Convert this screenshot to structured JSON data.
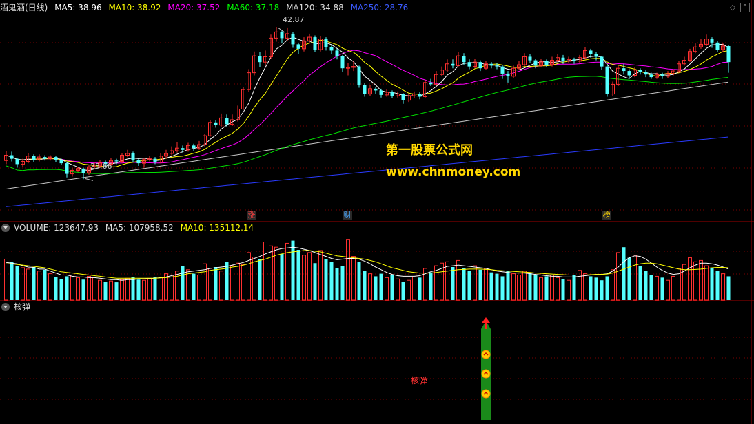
{
  "main_header": {
    "stock_name": "酒鬼酒(日线)",
    "indicators": [
      {
        "label": "MA5: 38.96",
        "color": "#ffffff"
      },
      {
        "label": "MA10: 38.92",
        "color": "#ffff00"
      },
      {
        "label": "MA20: 37.52",
        "color": "#ff00ff"
      },
      {
        "label": "MA60: 37.18",
        "color": "#00ff00"
      },
      {
        "label": "MA120: 34.88",
        "color": "#dddddd"
      },
      {
        "label": "MA250: 28.76",
        "color": "#3b5bff"
      }
    ]
  },
  "volume_header": {
    "indicators": [
      {
        "label": "VOLUME: 123647.93",
        "color": "#dddddd"
      },
      {
        "label": "MA5: 107958.52",
        "color": "#dddddd"
      },
      {
        "label": "MA10: 135112.14",
        "color": "#ffff00"
      }
    ]
  },
  "indicator_header": {
    "title": "核弹"
  },
  "watermark": {
    "line1": "第一股票公式网",
    "line2": "www.chnmoney.com"
  },
  "events": [
    {
      "label": "涨",
      "color": "#ff4040"
    },
    {
      "label": "财",
      "color": "#4aa8ff"
    },
    {
      "label": "榜",
      "color": "#ffd700"
    }
  ],
  "indicator_signal_label": "核弹",
  "colors": {
    "up": "#ff3030",
    "down": "#54ffff",
    "grid": "#7a0000",
    "signal": "#1a8a1a"
  },
  "chart_data": {
    "type": "candlestick",
    "price_range": [
      22,
      44.5
    ],
    "high_label": "42.87",
    "low_label": "25.66",
    "volume_range": [
      0,
      100000
    ],
    "candles": [
      {
        "o": 27.8,
        "c": 28.4,
        "h": 28.9,
        "l": 27.4
      },
      {
        "o": 28.4,
        "c": 28.0,
        "h": 28.8,
        "l": 27.7
      },
      {
        "o": 28.0,
        "c": 27.4,
        "h": 28.1,
        "l": 27.0
      },
      {
        "o": 27.4,
        "c": 27.7,
        "h": 28.0,
        "l": 27.1
      },
      {
        "o": 27.7,
        "c": 28.3,
        "h": 28.6,
        "l": 27.5
      },
      {
        "o": 28.3,
        "c": 27.9,
        "h": 28.5,
        "l": 27.6
      },
      {
        "o": 27.9,
        "c": 28.2,
        "h": 28.5,
        "l": 27.7
      },
      {
        "o": 28.2,
        "c": 28.0,
        "h": 28.4,
        "l": 27.8
      },
      {
        "o": 28.0,
        "c": 28.2,
        "h": 28.4,
        "l": 27.8
      },
      {
        "o": 28.2,
        "c": 27.9,
        "h": 28.3,
        "l": 27.6
      },
      {
        "o": 27.9,
        "c": 27.5,
        "h": 28.0,
        "l": 27.3
      },
      {
        "o": 27.5,
        "c": 26.3,
        "h": 27.6,
        "l": 25.9
      },
      {
        "o": 26.3,
        "c": 26.7,
        "h": 27.0,
        "l": 26.0
      },
      {
        "o": 26.7,
        "c": 26.9,
        "h": 27.1,
        "l": 26.5
      },
      {
        "o": 26.9,
        "c": 26.4,
        "h": 27.0,
        "l": 25.7
      },
      {
        "o": 26.4,
        "c": 27.1,
        "h": 27.3,
        "l": 26.2
      },
      {
        "o": 27.1,
        "c": 27.2,
        "h": 27.6,
        "l": 26.9
      },
      {
        "o": 27.2,
        "c": 27.6,
        "h": 27.9,
        "l": 27.0
      },
      {
        "o": 27.6,
        "c": 27.4,
        "h": 27.8,
        "l": 27.1
      },
      {
        "o": 27.4,
        "c": 27.8,
        "h": 28.1,
        "l": 27.2
      },
      {
        "o": 27.8,
        "c": 27.7,
        "h": 28.0,
        "l": 27.4
      },
      {
        "o": 27.7,
        "c": 28.4,
        "h": 28.6,
        "l": 27.5
      },
      {
        "o": 28.4,
        "c": 28.6,
        "h": 29.0,
        "l": 28.2
      },
      {
        "o": 28.6,
        "c": 27.9,
        "h": 28.8,
        "l": 27.6
      },
      {
        "o": 27.9,
        "c": 27.5,
        "h": 28.0,
        "l": 27.2
      },
      {
        "o": 27.5,
        "c": 27.9,
        "h": 28.1,
        "l": 27.0
      },
      {
        "o": 27.9,
        "c": 28.0,
        "h": 28.3,
        "l": 27.7
      },
      {
        "o": 28.0,
        "c": 27.6,
        "h": 28.2,
        "l": 27.4
      },
      {
        "o": 27.6,
        "c": 28.3,
        "h": 28.6,
        "l": 27.5
      },
      {
        "o": 28.3,
        "c": 28.6,
        "h": 29.0,
        "l": 28.0
      },
      {
        "o": 28.6,
        "c": 28.9,
        "h": 29.4,
        "l": 28.4
      },
      {
        "o": 28.9,
        "c": 29.2,
        "h": 29.9,
        "l": 28.7
      },
      {
        "o": 29.2,
        "c": 29.0,
        "h": 29.5,
        "l": 28.7
      },
      {
        "o": 29.0,
        "c": 29.5,
        "h": 29.8,
        "l": 28.8
      },
      {
        "o": 29.5,
        "c": 29.2,
        "h": 29.7,
        "l": 28.9
      },
      {
        "o": 29.2,
        "c": 29.6,
        "h": 30.0,
        "l": 29.0
      },
      {
        "o": 29.6,
        "c": 30.6,
        "h": 30.8,
        "l": 29.4
      },
      {
        "o": 30.6,
        "c": 32.1,
        "h": 32.4,
        "l": 30.5
      },
      {
        "o": 32.1,
        "c": 31.8,
        "h": 32.4,
        "l": 31.5
      },
      {
        "o": 31.8,
        "c": 32.6,
        "h": 33.1,
        "l": 31.6
      },
      {
        "o": 32.6,
        "c": 31.9,
        "h": 33.0,
        "l": 31.6
      },
      {
        "o": 31.9,
        "c": 32.4,
        "h": 33.0,
        "l": 31.7
      },
      {
        "o": 32.4,
        "c": 33.6,
        "h": 34.0,
        "l": 32.2
      },
      {
        "o": 33.6,
        "c": 35.8,
        "h": 36.1,
        "l": 33.5
      },
      {
        "o": 35.8,
        "c": 37.7,
        "h": 38.1,
        "l": 35.5
      },
      {
        "o": 37.7,
        "c": 39.6,
        "h": 40.1,
        "l": 37.4
      },
      {
        "o": 39.6,
        "c": 38.9,
        "h": 40.0,
        "l": 38.3
      },
      {
        "o": 38.9,
        "c": 39.5,
        "h": 40.2,
        "l": 38.5
      },
      {
        "o": 39.5,
        "c": 41.6,
        "h": 42.0,
        "l": 39.3
      },
      {
        "o": 41.6,
        "c": 42.3,
        "h": 42.87,
        "l": 41.2
      },
      {
        "o": 42.3,
        "c": 41.6,
        "h": 42.5,
        "l": 41.0
      },
      {
        "o": 41.6,
        "c": 42.1,
        "h": 42.8,
        "l": 41.3
      },
      {
        "o": 42.1,
        "c": 40.9,
        "h": 42.3,
        "l": 40.5
      },
      {
        "o": 40.9,
        "c": 40.4,
        "h": 41.1,
        "l": 39.8
      },
      {
        "o": 40.4,
        "c": 41.3,
        "h": 41.7,
        "l": 40.1
      },
      {
        "o": 41.3,
        "c": 41.7,
        "h": 42.1,
        "l": 41.0
      },
      {
        "o": 41.7,
        "c": 40.3,
        "h": 41.9,
        "l": 40.0
      },
      {
        "o": 40.3,
        "c": 41.5,
        "h": 41.8,
        "l": 40.1
      },
      {
        "o": 41.5,
        "c": 40.6,
        "h": 41.7,
        "l": 40.2
      },
      {
        "o": 40.6,
        "c": 40.2,
        "h": 40.8,
        "l": 39.8
      },
      {
        "o": 40.2,
        "c": 39.6,
        "h": 40.4,
        "l": 39.2
      },
      {
        "o": 39.6,
        "c": 38.2,
        "h": 39.7,
        "l": 37.8
      },
      {
        "o": 38.2,
        "c": 38.3,
        "h": 38.8,
        "l": 37.4
      },
      {
        "o": 38.3,
        "c": 38.4,
        "h": 39.0,
        "l": 37.9
      },
      {
        "o": 38.4,
        "c": 36.3,
        "h": 38.5,
        "l": 36.0
      },
      {
        "o": 36.3,
        "c": 35.3,
        "h": 36.5,
        "l": 35.0
      },
      {
        "o": 35.3,
        "c": 35.9,
        "h": 36.3,
        "l": 35.1
      },
      {
        "o": 35.9,
        "c": 35.7,
        "h": 36.1,
        "l": 35.3
      },
      {
        "o": 35.7,
        "c": 35.2,
        "h": 35.9,
        "l": 34.9
      },
      {
        "o": 35.2,
        "c": 35.5,
        "h": 35.8,
        "l": 35.0
      },
      {
        "o": 35.5,
        "c": 35.1,
        "h": 35.7,
        "l": 34.8
      },
      {
        "o": 35.1,
        "c": 35.3,
        "h": 35.6,
        "l": 34.9
      },
      {
        "o": 35.3,
        "c": 34.6,
        "h": 35.4,
        "l": 34.2
      },
      {
        "o": 34.6,
        "c": 35.1,
        "h": 35.3,
        "l": 34.4
      },
      {
        "o": 35.1,
        "c": 35.3,
        "h": 35.6,
        "l": 34.8
      },
      {
        "o": 35.3,
        "c": 35.0,
        "h": 35.5,
        "l": 34.7
      },
      {
        "o": 35.0,
        "c": 36.6,
        "h": 36.9,
        "l": 34.9
      },
      {
        "o": 36.6,
        "c": 36.4,
        "h": 37.0,
        "l": 36.2
      },
      {
        "o": 36.4,
        "c": 37.5,
        "h": 37.9,
        "l": 36.3
      },
      {
        "o": 37.5,
        "c": 38.0,
        "h": 38.4,
        "l": 37.3
      },
      {
        "o": 38.0,
        "c": 38.7,
        "h": 39.2,
        "l": 37.8
      },
      {
        "o": 38.7,
        "c": 38.5,
        "h": 39.2,
        "l": 38.2
      },
      {
        "o": 38.5,
        "c": 39.6,
        "h": 40.0,
        "l": 38.4
      },
      {
        "o": 39.6,
        "c": 38.9,
        "h": 39.9,
        "l": 38.6
      },
      {
        "o": 38.9,
        "c": 38.4,
        "h": 39.2,
        "l": 38.1
      },
      {
        "o": 38.4,
        "c": 38.9,
        "h": 39.3,
        "l": 38.2
      },
      {
        "o": 38.9,
        "c": 38.2,
        "h": 39.1,
        "l": 37.9
      },
      {
        "o": 38.2,
        "c": 38.7,
        "h": 39.0,
        "l": 38.0
      },
      {
        "o": 38.7,
        "c": 38.5,
        "h": 38.9,
        "l": 38.2
      },
      {
        "o": 38.5,
        "c": 38.4,
        "h": 38.8,
        "l": 38.1
      },
      {
        "o": 38.4,
        "c": 37.6,
        "h": 38.6,
        "l": 37.0
      },
      {
        "o": 37.6,
        "c": 37.3,
        "h": 37.9,
        "l": 36.6
      },
      {
        "o": 37.3,
        "c": 38.2,
        "h": 38.5,
        "l": 37.1
      },
      {
        "o": 38.2,
        "c": 38.6,
        "h": 39.0,
        "l": 38.0
      },
      {
        "o": 38.6,
        "c": 39.5,
        "h": 39.9,
        "l": 38.4
      },
      {
        "o": 39.5,
        "c": 39.1,
        "h": 39.8,
        "l": 38.8
      },
      {
        "o": 39.1,
        "c": 38.5,
        "h": 39.3,
        "l": 38.2
      },
      {
        "o": 38.5,
        "c": 39.0,
        "h": 39.3,
        "l": 38.3
      },
      {
        "o": 39.0,
        "c": 38.6,
        "h": 39.2,
        "l": 38.3
      },
      {
        "o": 38.6,
        "c": 39.1,
        "h": 39.5,
        "l": 38.4
      },
      {
        "o": 39.1,
        "c": 39.4,
        "h": 39.8,
        "l": 38.9
      },
      {
        "o": 39.4,
        "c": 39.0,
        "h": 39.7,
        "l": 38.7
      },
      {
        "o": 39.0,
        "c": 39.2,
        "h": 39.5,
        "l": 38.8
      },
      {
        "o": 39.2,
        "c": 39.0,
        "h": 39.4,
        "l": 38.7
      },
      {
        "o": 39.0,
        "c": 39.4,
        "h": 39.7,
        "l": 38.8
      },
      {
        "o": 39.4,
        "c": 40.2,
        "h": 40.6,
        "l": 39.2
      },
      {
        "o": 40.2,
        "c": 39.8,
        "h": 40.4,
        "l": 39.4
      },
      {
        "o": 39.8,
        "c": 39.5,
        "h": 40.0,
        "l": 39.1
      },
      {
        "o": 39.5,
        "c": 38.4,
        "h": 39.6,
        "l": 38.0
      },
      {
        "o": 38.4,
        "c": 35.3,
        "h": 38.6,
        "l": 35.0
      },
      {
        "o": 35.3,
        "c": 36.4,
        "h": 36.7,
        "l": 35.1
      },
      {
        "o": 36.4,
        "c": 38.2,
        "h": 38.6,
        "l": 36.2
      },
      {
        "o": 38.2,
        "c": 37.9,
        "h": 38.7,
        "l": 37.5
      },
      {
        "o": 37.9,
        "c": 37.4,
        "h": 38.1,
        "l": 37.0
      },
      {
        "o": 37.4,
        "c": 38.0,
        "h": 38.3,
        "l": 37.2
      },
      {
        "o": 38.0,
        "c": 37.8,
        "h": 38.2,
        "l": 37.5
      },
      {
        "o": 37.8,
        "c": 37.5,
        "h": 38.0,
        "l": 37.2
      },
      {
        "o": 37.5,
        "c": 37.2,
        "h": 37.7,
        "l": 37.0
      },
      {
        "o": 37.2,
        "c": 37.5,
        "h": 37.7,
        "l": 37.0
      },
      {
        "o": 37.5,
        "c": 37.3,
        "h": 37.7,
        "l": 37.0
      },
      {
        "o": 37.3,
        "c": 37.6,
        "h": 37.9,
        "l": 37.1
      },
      {
        "o": 37.6,
        "c": 37.9,
        "h": 38.1,
        "l": 37.4
      },
      {
        "o": 37.9,
        "c": 38.7,
        "h": 39.0,
        "l": 37.7
      },
      {
        "o": 38.7,
        "c": 39.1,
        "h": 39.5,
        "l": 38.5
      },
      {
        "o": 39.1,
        "c": 40.1,
        "h": 40.4,
        "l": 38.9
      },
      {
        "o": 40.1,
        "c": 40.6,
        "h": 41.0,
        "l": 39.9
      },
      {
        "o": 40.6,
        "c": 40.9,
        "h": 41.5,
        "l": 40.4
      },
      {
        "o": 40.9,
        "c": 41.5,
        "h": 42.0,
        "l": 40.7
      },
      {
        "o": 41.5,
        "c": 41.1,
        "h": 41.7,
        "l": 40.5
      },
      {
        "o": 41.1,
        "c": 40.3,
        "h": 41.3,
        "l": 40.0
      },
      {
        "o": 40.3,
        "c": 40.7,
        "h": 41.0,
        "l": 40.0
      },
      {
        "o": 40.7,
        "c": 38.9,
        "h": 40.8,
        "l": 37.7
      }
    ],
    "volume": [
      62000,
      58000,
      52000,
      49000,
      47000,
      50000,
      44000,
      46000,
      40000,
      35000,
      32000,
      36000,
      38000,
      34000,
      31000,
      36000,
      34000,
      30000,
      28000,
      29000,
      27000,
      31000,
      33000,
      35000,
      31000,
      30000,
      33000,
      35000,
      34000,
      40000,
      38000,
      44000,
      52000,
      46000,
      40000,
      38000,
      55000,
      48000,
      50000,
      44000,
      58000,
      52000,
      56000,
      54000,
      72000,
      65000,
      62000,
      88000,
      82000,
      80000,
      70000,
      86000,
      90000,
      76000,
      68000,
      72000,
      56000,
      75000,
      62000,
      58000,
      48000,
      52000,
      92000,
      66000,
      58000,
      44000,
      40000,
      36000,
      40000,
      34000,
      38000,
      32000,
      28000,
      30000,
      35000,
      34000,
      48000,
      42000,
      52000,
      56000,
      58000,
      50000,
      60000,
      48000,
      44000,
      52000,
      46000,
      48000,
      42000,
      40000,
      36000,
      44000,
      40000,
      38000,
      44000,
      42000,
      38000,
      34000,
      36000,
      38000,
      34000,
      32000,
      30000,
      38000,
      45000,
      40000,
      36000,
      34000,
      30000,
      36000,
      46000,
      72000,
      80000,
      64000,
      68000,
      52000,
      44000,
      38000,
      36000,
      34000,
      30000,
      36000,
      48000,
      54000,
      64000,
      58000,
      60000,
      52000,
      48000,
      44000,
      40000,
      36000
    ],
    "volume_ma5": [
      57000,
      56000,
      55000,
      52000,
      50000,
      49500,
      47000,
      47000,
      44000,
      41000,
      38000,
      38000,
      36000,
      35000,
      35000,
      34000,
      34000,
      33000,
      32000,
      31000,
      31000,
      30000,
      31000,
      31000,
      32000,
      32000,
      32500,
      33000,
      34000,
      35000,
      37000,
      39000,
      41000,
      43000,
      44000,
      45000,
      46000,
      48000,
      49000,
      50000,
      51000,
      53000,
      55000,
      57000,
      60000,
      63000,
      66000,
      70000,
      73000,
      76000,
      78000,
      79000,
      80000,
      79000,
      77000,
      75000,
      72000,
      69000,
      66000,
      63000,
      61000,
      62000,
      63000,
      63000,
      62000,
      59000,
      55000,
      50000,
      46000,
      42000,
      39000,
      37000,
      36000,
      36000,
      36000,
      37000,
      40000,
      43000,
      45000,
      48000,
      51000,
      52000,
      53000,
      52000,
      51000,
      50000,
      49000,
      48000,
      46000,
      44000,
      43000,
      42000,
      41000,
      41000,
      41000,
      40000,
      39000,
      38000,
      37000,
      36000,
      36000,
      35000,
      35000,
      35000,
      36000,
      37000,
      38000,
      39000,
      39000,
      40000,
      44000,
      50000,
      58000,
      64000,
      67000,
      66000,
      62000,
      56000,
      50000,
      45000,
      41000,
      39000,
      40000,
      44000,
      49000,
      53000,
      56000,
      56000,
      55000,
      53000,
      50000,
      47000
    ],
    "volume_ma10": [
      55000,
      55000,
      54000,
      53000,
      52000,
      51000,
      50000,
      49000,
      47000,
      45000,
      43000,
      42000,
      41000,
      40000,
      39000,
      38000,
      37000,
      36000,
      35000,
      34000,
      33000,
      33000,
      33000,
      33000,
      33000,
      33000,
      33000,
      33000,
      33500,
      34000,
      35000,
      36000,
      38000,
      40000,
      41000,
      42000,
      43000,
      45000,
      46000,
      47000,
      48000,
      50000,
      51000,
      53000,
      55000,
      58000,
      60000,
      62000,
      65000,
      68000,
      70000,
      72000,
      73000,
      74000,
      75000,
      75000,
      74000,
      73000,
      71000,
      69000,
      67000,
      66000,
      65000,
      64000,
      63000,
      62000,
      60000,
      58000,
      55000,
      52000,
      49000,
      47000,
      45000,
      43000,
      42000,
      41000,
      41000,
      41000,
      42000,
      43000,
      44000,
      45000,
      46000,
      46500,
      47000,
      47000,
      47000,
      46500,
      46000,
      45000,
      44500,
      44000,
      43500,
      43000,
      42500,
      42000,
      41000,
      40500,
      40000,
      39500,
      39000,
      38500,
      38000,
      38000,
      38000,
      38000,
      38500,
      39000,
      39000,
      39500,
      41000,
      44000,
      47000,
      50000,
      53000,
      55000,
      56000,
      56000,
      55000,
      53000,
      51000,
      49000,
      47000,
      46000,
      46000,
      46500,
      47000,
      48000,
      49000,
      49500,
      49500,
      49000
    ],
    "signal": {
      "index": 87,
      "label": "核弹"
    }
  }
}
